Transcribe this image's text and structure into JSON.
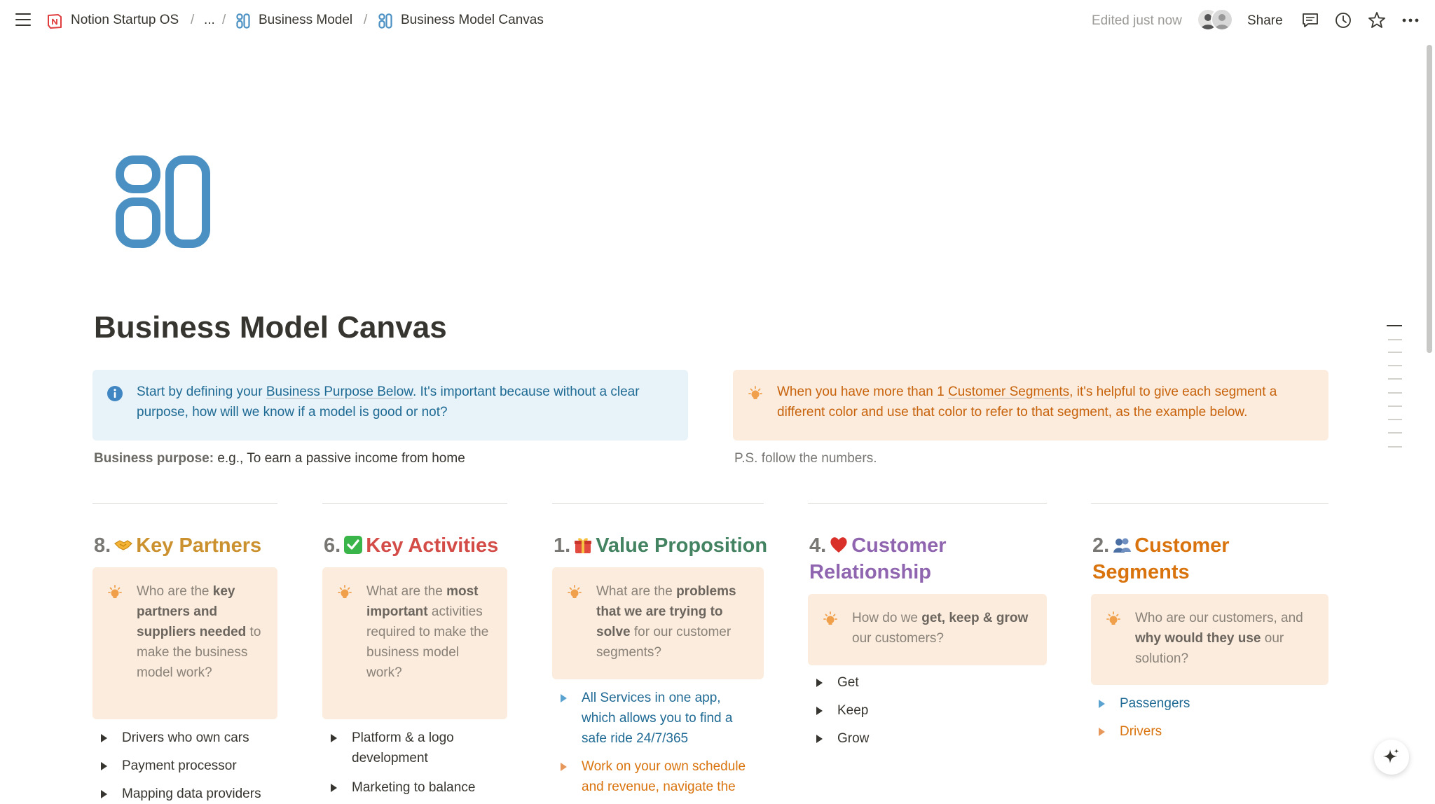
{
  "topbar": {
    "breadcrumb": [
      "Notion Startup OS",
      "...",
      "Business Model",
      "Business Model Canvas"
    ],
    "separator": "/",
    "edited": "Edited just now",
    "share": "Share"
  },
  "page": {
    "title": "Business Model Canvas"
  },
  "callouts": {
    "left": {
      "pre": "Start by defining your ",
      "link": "Business Purpose Below",
      "post": ". It's important because without a clear purpose, how will we know if a model is good or not?"
    },
    "right": {
      "pre": "When you have more than 1 ",
      "link": "Customer Segments",
      "post": ", it's helpful to give each segment a different color and use that color to refer to that segment, as the example below."
    }
  },
  "notes": {
    "purpose_label": "Business purpose:",
    "purpose_value": " e.g., To earn a passive income from home",
    "ps": "P.S. follow the numbers."
  },
  "columns": [
    {
      "num": "8.",
      "title": "Key Partners",
      "emoji": "handshake",
      "color": "#cb912f",
      "callout": [
        "Who are the ",
        "key partners and suppliers needed",
        " to make the business model work?"
      ],
      "items": [
        "Drivers who own cars",
        "Payment processor",
        "Mapping data providers"
      ]
    },
    {
      "num": "6.",
      "title": "Key Activities",
      "emoji": "check-mark",
      "color": "#d44c47",
      "callout": [
        "What are the ",
        "most important",
        " activities required to make the business model work?"
      ],
      "items": [
        "Platform & a logo development",
        "Marketing to balance"
      ]
    },
    {
      "num": "1.",
      "title": "Value Proposition",
      "emoji": "gift",
      "color": "#448361",
      "callout": [
        "What are the ",
        "problems that we are trying to solve",
        " for our customer segments?"
      ],
      "items": [
        "All Services in one app, which allows you to find a safe ride 24/7/365",
        "Work on your own schedule and revenue, navigate the"
      ]
    },
    {
      "num": "4.",
      "title": "Customer Relationship",
      "emoji": "heart",
      "color": "#9065b0",
      "callout": [
        "How do we ",
        "get, keep & grow",
        " our customers?"
      ],
      "items": [
        "Get",
        "Keep",
        "Grow"
      ]
    },
    {
      "num": "2.",
      "title": "Customer Segments",
      "emoji": "people",
      "color": "#d9730d",
      "callout": [
        "Who are our customers, and ",
        "why would they use",
        " our solution?"
      ],
      "items": [
        "Passengers",
        "Drivers"
      ]
    }
  ],
  "colors": {
    "blue_text": "#1f6a94",
    "orange_text": "#c7620b",
    "icon_blue": "#4a90c2"
  }
}
